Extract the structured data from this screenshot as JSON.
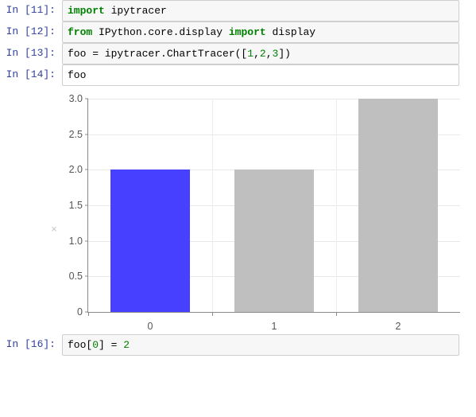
{
  "notebook": {
    "cells": [
      {
        "prompt": "In [11]:",
        "active": false,
        "tokens": [
          {
            "t": "kw",
            "s": "import"
          },
          {
            "t": "plain",
            "s": " ipytracer"
          }
        ]
      },
      {
        "prompt": "In [12]:",
        "active": false,
        "tokens": [
          {
            "t": "kw",
            "s": "from"
          },
          {
            "t": "plain",
            "s": " IPython.core.display "
          },
          {
            "t": "kw",
            "s": "import"
          },
          {
            "t": "plain",
            "s": " display"
          }
        ]
      },
      {
        "prompt": "In [13]:",
        "active": false,
        "tokens": [
          {
            "t": "plain",
            "s": "foo = ipytracer.ChartTracer(["
          },
          {
            "t": "num",
            "s": "1"
          },
          {
            "t": "plain",
            "s": ","
          },
          {
            "t": "num",
            "s": "2"
          },
          {
            "t": "plain",
            "s": ","
          },
          {
            "t": "num",
            "s": "3"
          },
          {
            "t": "plain",
            "s": "])"
          }
        ]
      },
      {
        "prompt": "In [14]:",
        "active": true,
        "tokens": [
          {
            "t": "plain",
            "s": "foo"
          }
        ]
      }
    ],
    "trailing_cell": {
      "prompt": "In [16]:",
      "active": false,
      "tokens": [
        {
          "t": "plain",
          "s": "foo["
        },
        {
          "t": "num",
          "s": "0"
        },
        {
          "t": "plain",
          "s": "] = "
        },
        {
          "t": "num",
          "s": "2"
        }
      ]
    }
  },
  "output": {
    "close_icon": "×",
    "close_icon_name": "close-output-icon"
  },
  "chart_data": {
    "type": "bar",
    "title": "",
    "xlabel": "",
    "ylabel": "",
    "categories": [
      "0",
      "1",
      "2"
    ],
    "values": [
      2,
      2,
      3
    ],
    "bar_colors": [
      "#4740ff",
      "#bfbfbf",
      "#bfbfbf"
    ],
    "highlight_index": 0,
    "highlight_color": "#4740ff",
    "default_color": "#bfbfbf",
    "ylim": [
      0,
      3.0
    ],
    "yticks": [
      0,
      0.5,
      1.0,
      1.5,
      2.0,
      2.5,
      3.0
    ],
    "ytick_labels": [
      "0",
      "0.5",
      "1.0",
      "1.5",
      "2.0",
      "2.5",
      "3.0"
    ],
    "xticks": [
      0,
      1,
      2
    ],
    "xtick_labels": [
      "0",
      "1",
      "2"
    ],
    "grid": true,
    "legend": "none"
  },
  "colors": {
    "prompt": "#303f9f",
    "keyword": "#008000",
    "number": "#008000",
    "cell_bg": "#f7f7f7",
    "cell_border": "#cfcfcf",
    "axis": "#8a8a8a",
    "gridline": "#e8e8e8",
    "tick_text": "#555555"
  }
}
